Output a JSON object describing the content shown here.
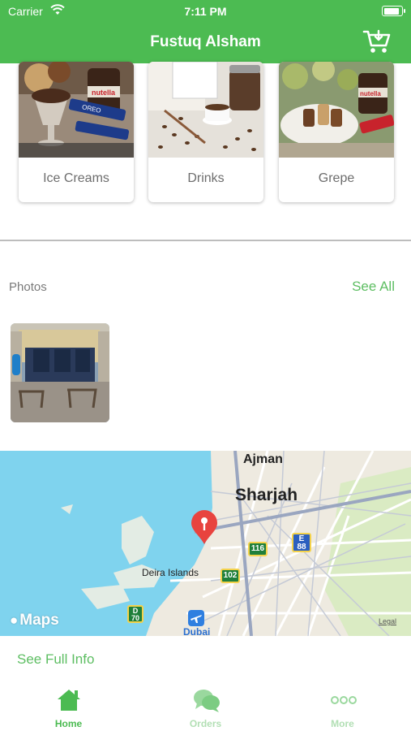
{
  "status_bar": {
    "carrier": "Carrier",
    "time": "7:11 PM",
    "battery_level": 0.9
  },
  "header": {
    "title": "Fustuq Alsham",
    "cart_icon": "cart-download-icon"
  },
  "categories": [
    {
      "label": "Ice Creams"
    },
    {
      "label": "Drinks"
    },
    {
      "label": "Grepe"
    }
  ],
  "photos": {
    "title": "Photos",
    "see_all": "See All"
  },
  "map": {
    "attribution": "Maps",
    "legal": "Legal",
    "labels": {
      "ajman": "Ajman",
      "sharjah": "Sharjah",
      "deira": "Deira Islands",
      "dubai": "Dubai",
      "road_116": "116",
      "road_102": "102",
      "road_88": "88",
      "road_e": "E",
      "road_70": "70",
      "road_d": "D"
    }
  },
  "see_full_info": "See Full Info",
  "tabs": [
    {
      "label": "Home",
      "icon": "home-icon",
      "active": true
    },
    {
      "label": "Orders",
      "icon": "chat-bubbles-icon",
      "active": false
    },
    {
      "label": "More",
      "icon": "more-dots-icon",
      "active": false
    }
  ],
  "colors": {
    "brand_green": "#4cbb52",
    "link_green": "#5dbe62",
    "water": "#7fd3ee",
    "land": "#eeeae0"
  }
}
